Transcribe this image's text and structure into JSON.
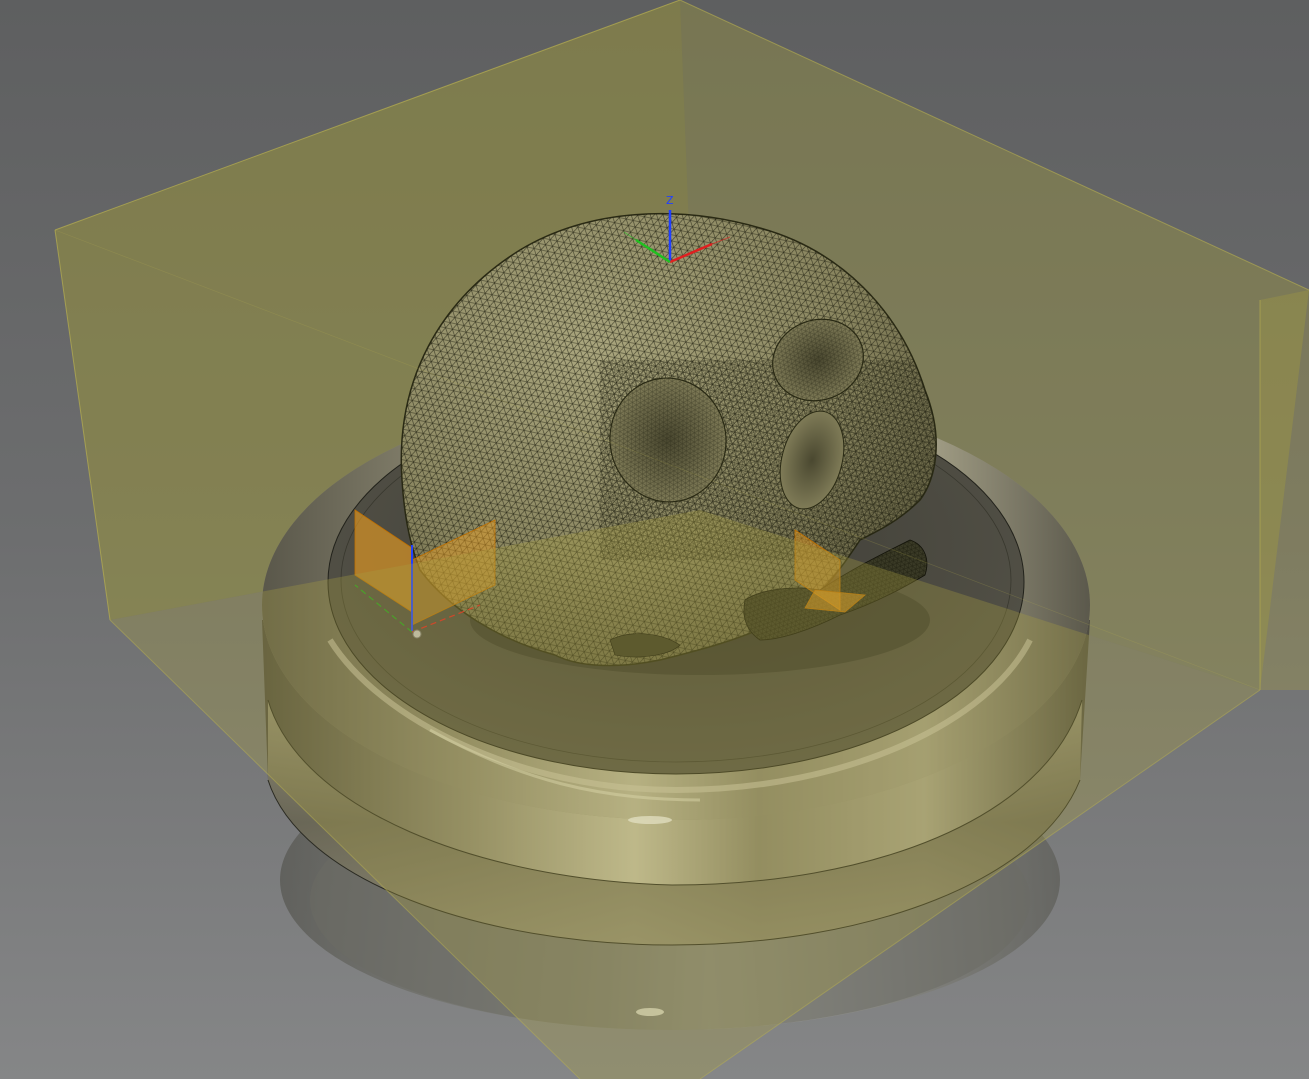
{
  "viewport": {
    "background": "#6f7071",
    "background_top": "#5e5f60",
    "background_bottom": "#858687"
  },
  "scene": {
    "model": "skull-mesh",
    "mesh_color": "#8a8660",
    "mesh_line_color": "#222210",
    "bounding_box_color": "#a8a040",
    "base_metal_color": "#7b7764",
    "work_origin_color": "#f0a020"
  },
  "axis_triad": {
    "z_label": "Z",
    "x_color": "#e02020",
    "y_color": "#20c020",
    "z_color": "#2040ff"
  }
}
